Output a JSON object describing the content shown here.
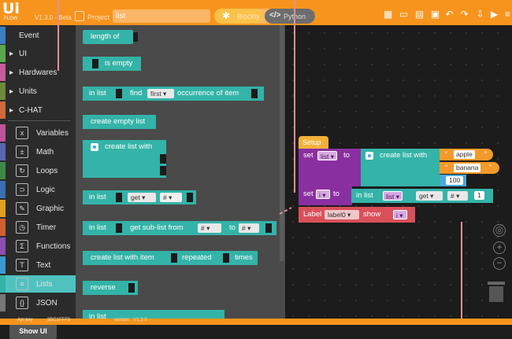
{
  "app": {
    "logo": "Ui",
    "logo_sub": "FLOW",
    "version": "V1.3.0 - Beta",
    "project_label": "Project",
    "project_name": "list",
    "mode_blockly": "Blockly",
    "mode_python": "Python",
    "brand_color": "#f7941d",
    "toolbar_icons": [
      "device-icon",
      "chat-icon",
      "usb-icon",
      "terminal-icon",
      "undo-icon",
      "redo-icon",
      "download-icon",
      "run-icon",
      "menu-icon"
    ]
  },
  "sidebar": {
    "top_items": [
      "Event",
      "UI",
      "Hardwares",
      "Units",
      "C-HAT"
    ],
    "categories": [
      {
        "label": "Variables",
        "icon": "variables-icon",
        "color": "#c0539a",
        "glyph": "x"
      },
      {
        "label": "Math",
        "icon": "math-icon",
        "color": "#5a66b0",
        "glyph": "±"
      },
      {
        "label": "Loops",
        "icon": "loops-icon",
        "color": "#3c8a4a",
        "glyph": "↻"
      },
      {
        "label": "Logic",
        "icon": "logic-icon",
        "color": "#3a6fb0",
        "glyph": "⊃"
      },
      {
        "label": "Graphic",
        "icon": "graphic-icon",
        "color": "#e0a020",
        "glyph": "✎"
      },
      {
        "label": "Timer",
        "icon": "timer-icon",
        "color": "#d06030",
        "glyph": "◷"
      },
      {
        "label": "Functions",
        "icon": "functions-icon",
        "color": "#8a4fb0",
        "glyph": "Σ"
      },
      {
        "label": "Text",
        "icon": "text-icon",
        "color": "#3a9ad0",
        "glyph": "T"
      },
      {
        "label": "Lists",
        "icon": "lists-icon",
        "color": "#34b3a8",
        "glyph": "≡"
      },
      {
        "label": "JSON",
        "icon": "json-icon",
        "color": "#777777",
        "glyph": "{}"
      }
    ],
    "selected": "Lists",
    "show_ui": "Show UI"
  },
  "flyout": {
    "length_of": "length of",
    "is_empty": "is empty",
    "in_list": "in list",
    "find": "find",
    "first": "first ▾",
    "occurrence": "occurrence of item",
    "create_empty": "create empty list",
    "create_with": "create list with",
    "get": "get ▾",
    "hash": "# ▾",
    "get_sub": "get sub-list from",
    "to": "to",
    "create_repeated": "create list with item",
    "repeated": "repeated",
    "times": "times",
    "reverse": "reverse",
    "in_list_partial": "in list"
  },
  "workspace": {
    "setup": "Setup",
    "set": "set",
    "list_var": "list ▾",
    "to": "to",
    "create_with": "create list with",
    "items": [
      "apple",
      "banana"
    ],
    "number": "100",
    "i_var": "i ▾",
    "in_list": "in list",
    "get": "get ▾",
    "hash": "# ▾",
    "index": "1",
    "label_text": "Label",
    "label_name": "label0 ▾",
    "show": "show",
    "show_arg": "i ▾"
  },
  "footer": {
    "api_key": "Api key",
    "api_value": "3BC1FFF8",
    "version": "version : V1.3.0"
  }
}
